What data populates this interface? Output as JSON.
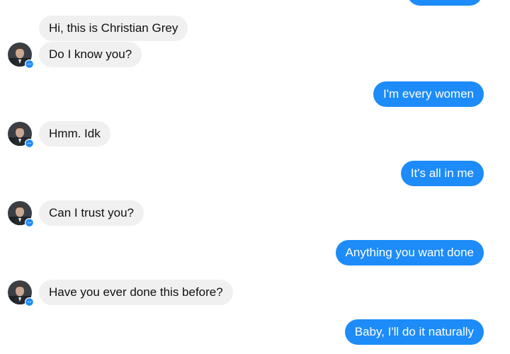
{
  "colors": {
    "incoming_bubble": "#f1f0f0",
    "outgoing_bubble": "#1d8cf8",
    "messenger_badge": "#1d8cf8"
  },
  "contact": {
    "avatar_icon": "profile-photo-icon",
    "badge_icon": "messenger-badge-icon"
  },
  "messages": [
    {
      "dir": "in",
      "text": "Hi, this is Christian Grey"
    },
    {
      "dir": "in",
      "text": "Do I know you?"
    },
    {
      "dir": "out",
      "text": "I'm every women"
    },
    {
      "dir": "in",
      "text": "Hmm. Idk"
    },
    {
      "dir": "out",
      "text": "It's all in me"
    },
    {
      "dir": "in",
      "text": "Can I trust you?"
    },
    {
      "dir": "out",
      "text": "Anything you want done"
    },
    {
      "dir": "in",
      "text": "Have you ever done this before?"
    },
    {
      "dir": "out",
      "text": "Baby, I'll do it naturally"
    }
  ]
}
